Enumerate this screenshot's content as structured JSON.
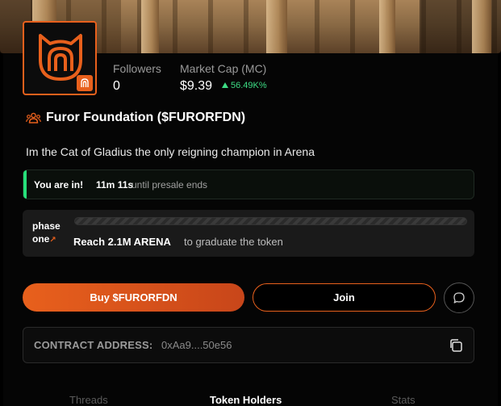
{
  "profile": {
    "followers_label": "Followers",
    "followers_value": "0",
    "market_cap_label": "Market Cap (MC)",
    "market_cap_value": "$9.39",
    "market_cap_change": "56.49K%"
  },
  "token": {
    "title": "Furor Foundation ($FURORFDN)",
    "description": "Im the Cat of Gladius the only reigning champion in Arena"
  },
  "presale": {
    "status": "You are in!",
    "time_left": "11m 11s",
    "suffix": "until presale ends"
  },
  "phase": {
    "label_line1": "phase",
    "label_line2": "one",
    "progress_fraction": 0.0,
    "goal": "Reach 2.1M ARENA",
    "goal_rest": "to graduate the token"
  },
  "actions": {
    "buy_label": "Buy $FURORFDN",
    "join_label": "Join"
  },
  "contract": {
    "label": "CONTRACT ADDRESS:",
    "value": "0xAa9....50e56"
  },
  "tabs": [
    {
      "label": "Threads",
      "active": false
    },
    {
      "label": "Token Holders",
      "active": true
    },
    {
      "label": "Stats",
      "active": false
    }
  ],
  "colors": {
    "accent": "#e8601c",
    "positive": "#3ddc84",
    "presale_accent": "#26e07a"
  },
  "icons": {
    "avatar_logo": "cat-head-logo",
    "badge": "arena-badge-icon",
    "title_icon": "community-icon",
    "chat": "chat-bubble-icon",
    "copy": "copy-icon",
    "change": "triangle-up-icon"
  }
}
